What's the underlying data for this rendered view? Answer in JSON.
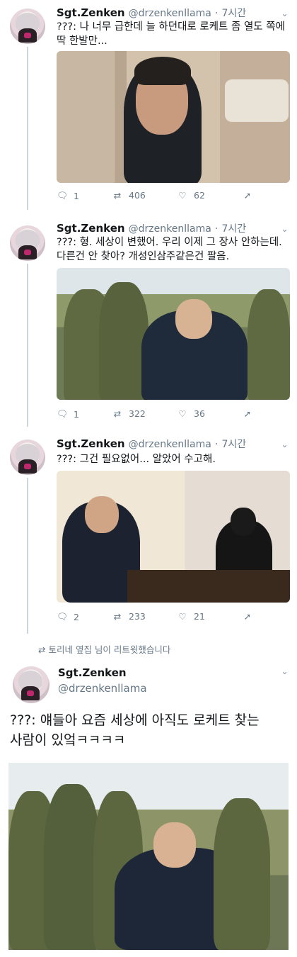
{
  "tweets": [
    {
      "name": "Sgt.Zenken",
      "handle": "@drzenkenllama",
      "sep": "·",
      "time": "7시간",
      "text": "???: 나 너무 급한데 늘 하던대로 로케트 좀 열도 쪽에 딱 한발만...",
      "counts": {
        "reply": "1",
        "retweet": "406",
        "like": "62"
      }
    },
    {
      "name": "Sgt.Zenken",
      "handle": "@drzenkenllama",
      "sep": "·",
      "time": "7시간",
      "text": "???: 형. 세상이 변했어. 우리 이제 그 장사 안하는데. 다른건 안 찾아? 개성인삼주같은건 팔음.",
      "counts": {
        "reply": "1",
        "retweet": "322",
        "like": "36"
      }
    },
    {
      "name": "Sgt.Zenken",
      "handle": "@drzenkenllama",
      "sep": "·",
      "time": "7시간",
      "text": "???: 그건 필요없어... 알았어 수고해.",
      "counts": {
        "reply": "2",
        "retweet": "233",
        "like": "21"
      }
    }
  ],
  "retweet_note": "토리네 옆집 님이 리트윗했습니다",
  "retweeted": {
    "name": "Sgt.Zenken",
    "handle": "@drzenkenllama",
    "text": "???: 얘들아 요즘 세상에 아직도 로케트 찾는 사람이 있엌ㅋㅋㅋㅋ"
  },
  "icons": {
    "reply": "reply-icon",
    "retweet": "retweet-icon",
    "like": "heart-icon",
    "share": "share-icon",
    "chevron": "chevron-down-icon"
  }
}
